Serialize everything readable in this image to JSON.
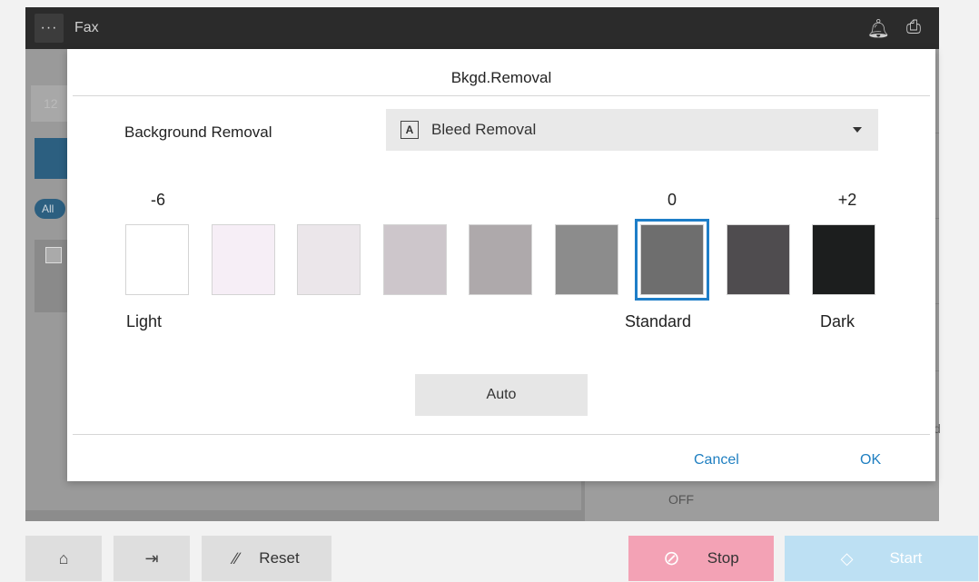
{
  "topbar": {
    "menu_label": "···",
    "title": "Fax",
    "icons": [
      "bell-icon",
      "status-icon"
    ]
  },
  "background": {
    "field_value": "12",
    "all_badge": "All",
    "memory_value": "OFF",
    "right_stub": "d"
  },
  "modal": {
    "title": "Bkgd.Removal",
    "bg_label": "Background Removal",
    "select_icon": "A",
    "select_value": "Bleed Removal",
    "scale_labels": {
      "left": "-6",
      "standard": "0",
      "right": "+2"
    },
    "end_labels": {
      "light": "Light",
      "standard": "Standard",
      "dark": "Dark"
    },
    "levels": [
      "#ffffff",
      "#f6eef6",
      "#ebe6ea",
      "#cdc6cb",
      "#aea9ab",
      "#8c8c8c",
      "#6e6e6e",
      "#4f4c4f",
      "#1c1e1e"
    ],
    "selected_index": 6,
    "auto_label": "Auto",
    "cancel_label": "Cancel",
    "ok_label": "OK"
  },
  "bottom": {
    "reset_label": "Reset",
    "stop_label": "Stop",
    "start_label": "Start"
  },
  "colors": {
    "accent": "#1e7ec8",
    "stop": "#f3a2b5",
    "start": "#bde0f3"
  }
}
